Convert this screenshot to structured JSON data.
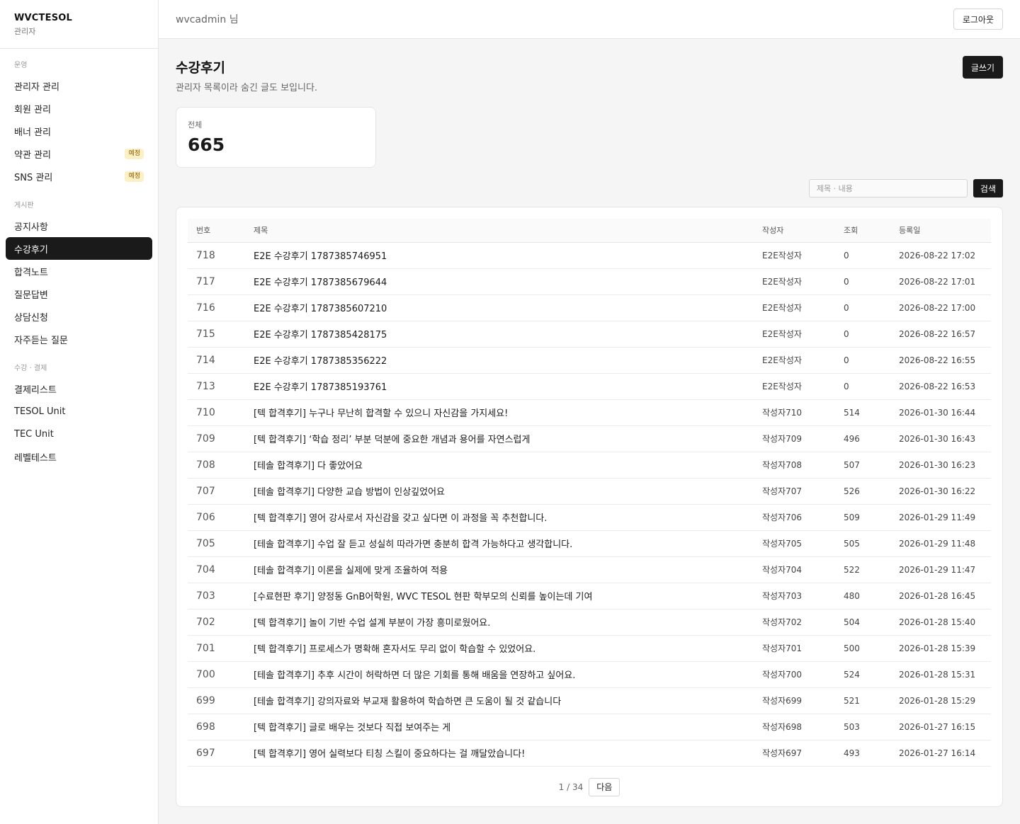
{
  "sidebar": {
    "brand": "WVCTESOL",
    "role": "관리자",
    "sections": [
      {
        "title": "운영",
        "items": [
          {
            "label": "관리자 관리",
            "badge": ""
          },
          {
            "label": "회원 관리",
            "badge": ""
          },
          {
            "label": "배너 관리",
            "badge": ""
          },
          {
            "label": "약관 관리",
            "badge": "예정"
          },
          {
            "label": "SNS 관리",
            "badge": "예정"
          }
        ]
      },
      {
        "title": "게시판",
        "items": [
          {
            "label": "공지사항",
            "badge": ""
          },
          {
            "label": "수강후기",
            "badge": "",
            "active": true
          },
          {
            "label": "합격노트",
            "badge": ""
          },
          {
            "label": "질문답변",
            "badge": ""
          },
          {
            "label": "상담신청",
            "badge": ""
          },
          {
            "label": "자주듣는 질문",
            "badge": ""
          }
        ]
      },
      {
        "title": "수강 · 결제",
        "items": [
          {
            "label": "결제리스트",
            "badge": ""
          },
          {
            "label": "TESOL Unit",
            "badge": ""
          },
          {
            "label": "TEC Unit",
            "badge": ""
          },
          {
            "label": "레벨테스트",
            "badge": ""
          }
        ]
      }
    ]
  },
  "topbar": {
    "user": "wvcadmin 님",
    "logout": "로그아웃"
  },
  "page": {
    "title": "수강후기",
    "subtitle": "관리자 목록이라 숨긴 글도 보입니다.",
    "write": "글쓰기"
  },
  "stats": {
    "label": "전체",
    "value": "665"
  },
  "search": {
    "placeholder": "제목 · 내용",
    "button": "검색"
  },
  "table": {
    "headers": [
      "번호",
      "제목",
      "작성자",
      "조회",
      "등록일"
    ],
    "rows": [
      [
        "718",
        "E2E 수강후기 1787385746951",
        "E2E작성자",
        "0",
        "2026-08-22 17:02"
      ],
      [
        "717",
        "E2E 수강후기 1787385679644",
        "E2E작성자",
        "0",
        "2026-08-22 17:01"
      ],
      [
        "716",
        "E2E 수강후기 1787385607210",
        "E2E작성자",
        "0",
        "2026-08-22 17:00"
      ],
      [
        "715",
        "E2E 수강후기 1787385428175",
        "E2E작성자",
        "0",
        "2026-08-22 16:57"
      ],
      [
        "714",
        "E2E 수강후기 1787385356222",
        "E2E작성자",
        "0",
        "2026-08-22 16:55"
      ],
      [
        "713",
        "E2E 수강후기 1787385193761",
        "E2E작성자",
        "0",
        "2026-08-22 16:53"
      ],
      [
        "710",
        "[텍 합격후기] 누구나 무난히 합격할 수 있으니 자신감을 가지세요!",
        "작성자710",
        "514",
        "2026-01-30 16:44"
      ],
      [
        "709",
        "[텍 합격후기] ‘학습 정리’ 부분 덕분에 중요한 개념과 용어를 자연스럽게",
        "작성자709",
        "496",
        "2026-01-30 16:43"
      ],
      [
        "708",
        "[테솔 합격후기] 다 좋았어요",
        "작성자708",
        "507",
        "2026-01-30 16:23"
      ],
      [
        "707",
        "[테솔 합격후기] 다양한 교습 방법이 인상깊었어요",
        "작성자707",
        "526",
        "2026-01-30 16:22"
      ],
      [
        "706",
        "[텍 합격후기] 영어 강사로서 자신감을 갖고 싶다면 이 과정을 꼭 추천합니다.",
        "작성자706",
        "509",
        "2026-01-29 11:49"
      ],
      [
        "705",
        "[테솔 합격후기] 수업 잘 듣고 성실히 따라가면 충분히 합격 가능하다고 생각합니다.",
        "작성자705",
        "505",
        "2026-01-29 11:48"
      ],
      [
        "704",
        "[테솔 합격후기] 이론을 실제에 맞게 조율하여 적용",
        "작성자704",
        "522",
        "2026-01-29 11:47"
      ],
      [
        "703",
        "[수료현판 후기] 양정동 GnB어학원, WVC TESOL 현판 학부모의 신뢰를 높이는데 기여",
        "작성자703",
        "480",
        "2026-01-28 16:45"
      ],
      [
        "702",
        "[텍 합격후기] 놀이 기반 수업 설계 부분이 가장 흥미로웠어요.",
        "작성자702",
        "504",
        "2026-01-28 15:40"
      ],
      [
        "701",
        "[텍 합격후기] 프로세스가 명확해 혼자서도 무리 없이 학습할 수 있었어요.",
        "작성자701",
        "500",
        "2026-01-28 15:39"
      ],
      [
        "700",
        "[테솔 합격후기] 추후 시간이 허락하면 더 많은 기회를 통해 배움을 연장하고 싶어요.",
        "작성자700",
        "524",
        "2026-01-28 15:31"
      ],
      [
        "699",
        "[테솔 합격후기] 강의자료와 부교재 활용하여 학습하면 큰 도움이 될 것 같습니다",
        "작성자699",
        "521",
        "2026-01-28 15:29"
      ],
      [
        "698",
        "[텍 합격후기] 글로 배우는 것보다 직접 보여주는 게",
        "작성자698",
        "503",
        "2026-01-27 16:15"
      ],
      [
        "697",
        "[텍 합격후기] 영어 실력보다 티칭 스킬이 중요하다는 걸 깨달았습니다!",
        "작성자697",
        "493",
        "2026-01-27 16:14"
      ]
    ]
  },
  "pagination": {
    "info": "1 / 34",
    "next": "다음"
  }
}
